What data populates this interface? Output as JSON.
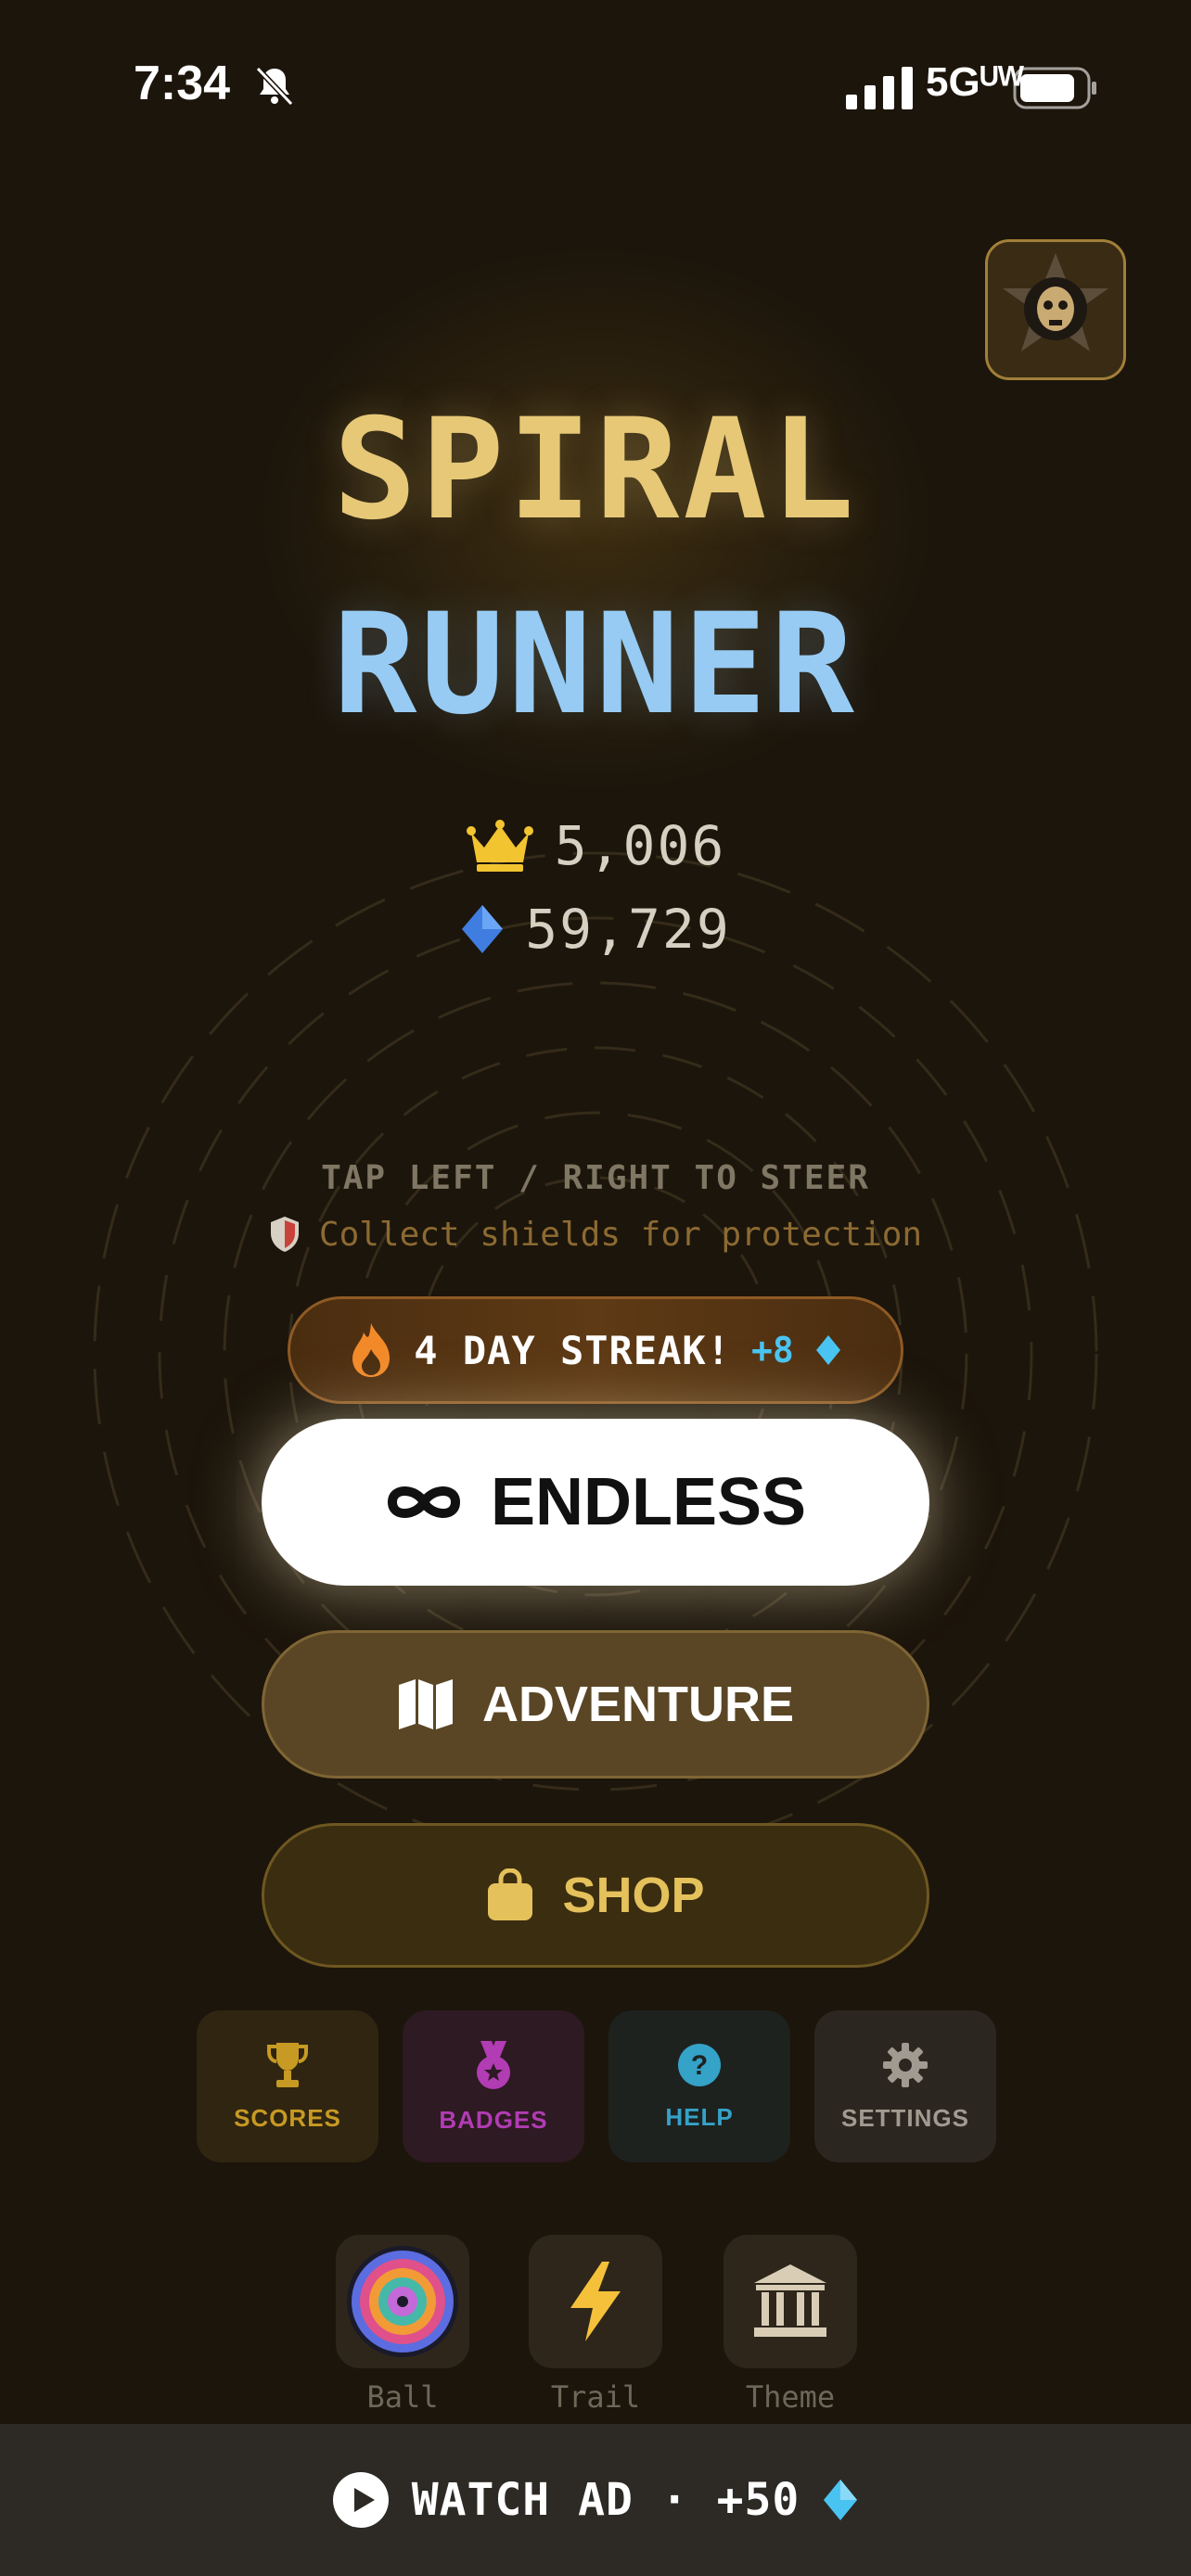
{
  "status_bar": {
    "time": "7:34",
    "network": "5Gᵁᵂ"
  },
  "title": {
    "line1": "SPIRAL",
    "line2": "RUNNER"
  },
  "stats": {
    "best_score": "5,006",
    "gems": "59,729"
  },
  "hints": {
    "steer": "TAP LEFT / RIGHT TO STEER",
    "shields": "Collect shields for protection"
  },
  "streak": {
    "label": "4 DAY STREAK!",
    "bonus": "+8"
  },
  "buttons": {
    "endless": "ENDLESS",
    "adventure": "ADVENTURE",
    "shop": "SHOP"
  },
  "tiles": [
    {
      "label": "SCORES",
      "icon": "trophy-icon"
    },
    {
      "label": "BADGES",
      "icon": "medal-icon"
    },
    {
      "label": "HELP",
      "icon": "question-icon"
    },
    {
      "label": "SETTINGS",
      "icon": "gear-icon"
    }
  ],
  "cosmetics": [
    {
      "label": "Ball",
      "icon": "ball-icon"
    },
    {
      "label": "Trail",
      "icon": "lightning-icon"
    },
    {
      "label": "Theme",
      "icon": "temple-icon"
    }
  ],
  "ad_bar": {
    "label": "WATCH AD · +50"
  },
  "colors": {
    "background": "#1c150b",
    "title_gold": "#e6c877",
    "title_blue": "#97cbf3",
    "gem_blue": "#49c4f2",
    "shop_gold": "#e4c15b"
  }
}
